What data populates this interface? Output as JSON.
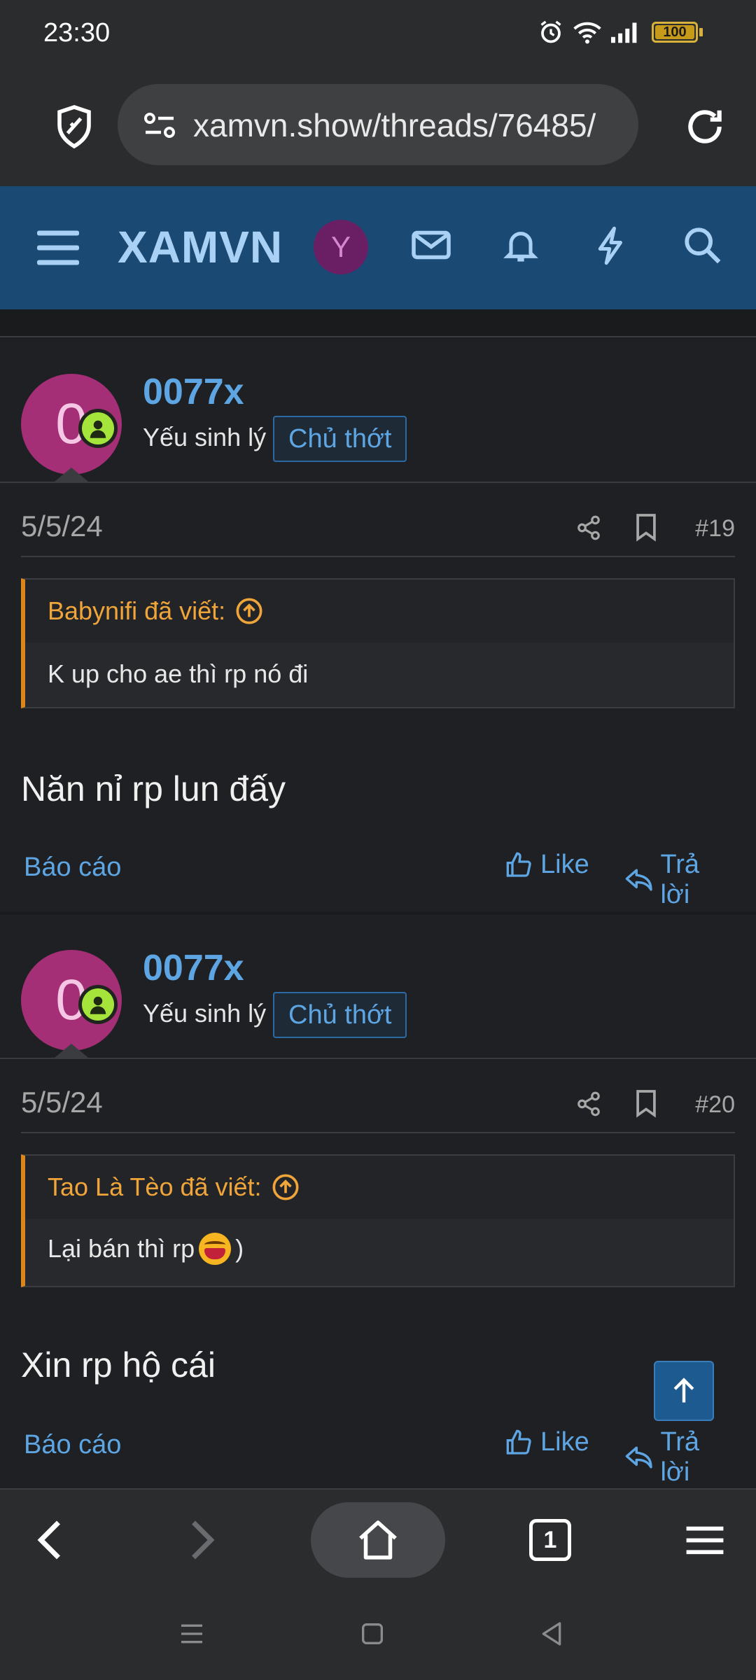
{
  "status": {
    "time": "23:30",
    "battery": "100"
  },
  "browser": {
    "url": "xamvn.show/threads/76485/"
  },
  "site": {
    "brand": "XAMVN",
    "avatar_letter": "Y"
  },
  "posts": [
    {
      "avatar_letter": "0",
      "username": "0077x",
      "user_title": "Yếu sinh lý",
      "badge": "Chủ thớt",
      "date": "5/5/24",
      "number": "#19",
      "quote_author": "Babynifi đã viết:",
      "quote_text": "K up cho ae thì rp nó đi",
      "body": "Năn nỉ rp lun đấy",
      "report": "Báo cáo",
      "like": "Like",
      "reply": "Trả lời"
    },
    {
      "avatar_letter": "0",
      "username": "0077x",
      "user_title": "Yếu sinh lý",
      "badge": "Chủ thớt",
      "date": "5/5/24",
      "number": "#20",
      "quote_author": "Tao Là Tèo đã viết:",
      "quote_text": "Lại bán thì rp",
      "quote_suffix": ")",
      "body": "Xin rp hộ cái",
      "report": "Báo cáo",
      "like": "Like",
      "reply": "Trả lời"
    }
  ],
  "bottom_nav": {
    "tab_count": "1"
  },
  "icons": [
    "alarm-icon",
    "wifi-icon",
    "signal-icon",
    "battery-icon",
    "shield-icon",
    "site-info-icon",
    "reload-icon",
    "menu-icon",
    "mail-icon",
    "bell-icon",
    "bolt-icon",
    "search-icon",
    "share-icon",
    "bookmark-icon",
    "arrow-circle-up-icon",
    "thumbs-up-icon",
    "reply-icon",
    "arrow-up-icon",
    "back-icon",
    "forward-icon",
    "home-icon",
    "tabs-icon",
    "overflow-menu-icon"
  ],
  "colors": {
    "header": "#1a4a73",
    "link": "#5ea6e3",
    "quote_accent": "#d9861c",
    "avatar": "#a42f77",
    "online": "#a5e43a"
  }
}
